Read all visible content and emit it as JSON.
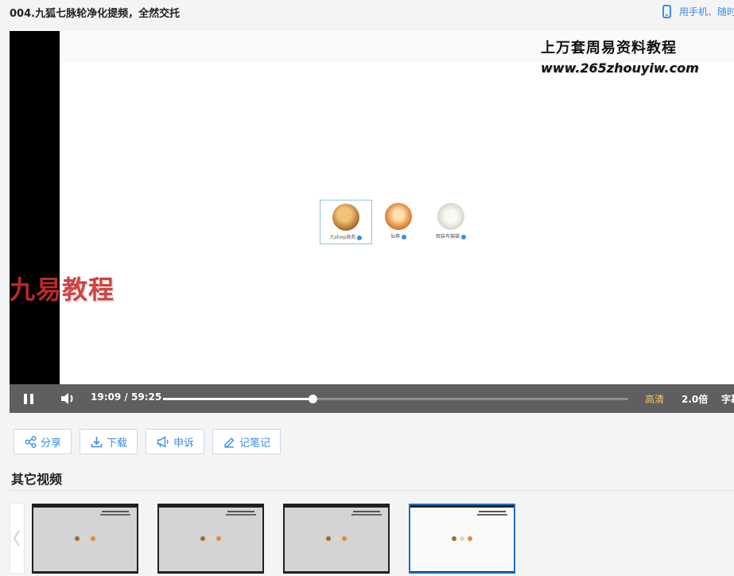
{
  "header": {
    "title": "004.九狐七脉轮净化提频，全然交托",
    "mobile_label": "用手机、随时"
  },
  "video": {
    "watermark_top_line1": "上万套周易资料教程",
    "watermark_top_line2": "www.265zhouyiw.com",
    "watermark_left": "九易教程",
    "avatars": [
      {
        "name": "九shop商务"
      },
      {
        "name": "仙尊"
      },
      {
        "name": "假装有猫猫"
      }
    ]
  },
  "controls": {
    "current_time": "19:09",
    "separator": "/",
    "total_time": "59:25",
    "progress": 0.322,
    "quality": "高清",
    "speed": "2.0倍",
    "subtitle": "字幕",
    "play_state": "playing",
    "colors": {
      "quality": "#f5c46b"
    }
  },
  "actions": [
    {
      "label": "分享",
      "icon": "share-icon"
    },
    {
      "label": "下载",
      "icon": "download-icon"
    },
    {
      "label": "申诉",
      "icon": "megaphone-icon"
    },
    {
      "label": "记笔记",
      "icon": "pencil-icon"
    }
  ],
  "other_videos": {
    "heading": "其它视频",
    "active_index": 3,
    "accent": "#1f6fc1"
  }
}
